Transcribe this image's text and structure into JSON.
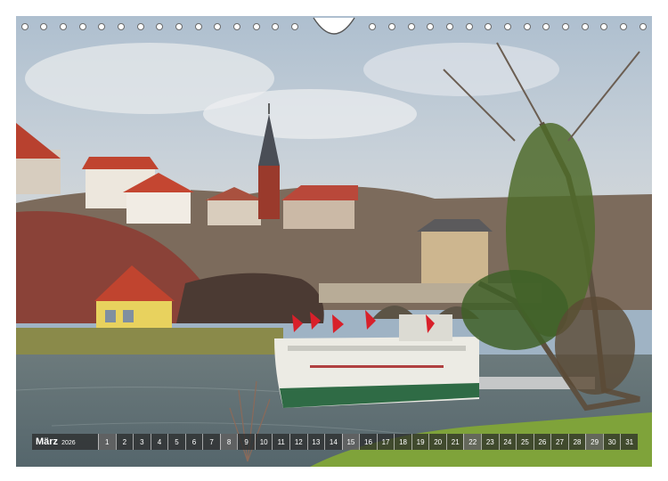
{
  "calendar": {
    "month": "März",
    "year": "2026",
    "days": [
      "1",
      "2",
      "3",
      "4",
      "5",
      "6",
      "7",
      "8",
      "9",
      "10",
      "11",
      "12",
      "13",
      "14",
      "15",
      "16",
      "17",
      "18",
      "19",
      "20",
      "21",
      "22",
      "23",
      "24",
      "25",
      "26",
      "27",
      "28",
      "29",
      "30",
      "31"
    ],
    "sundays": [
      1,
      8,
      15,
      22,
      29
    ]
  },
  "photo": {
    "subject": "river-town-with-church-and-passenger-ship",
    "colors": {
      "sky": "#b9c6d2",
      "river": "#6f7f86",
      "grass": "#7fa33a",
      "rooftops": "#c0442f",
      "ship_hull": "#ecebe4",
      "ship_stripe": "#2f6b45",
      "flags": "#d8202a",
      "pavilion": "#e8d25e",
      "rock": "#8a4238"
    }
  },
  "binding": {
    "hole_count_left": 15,
    "hole_count_right": 15
  }
}
